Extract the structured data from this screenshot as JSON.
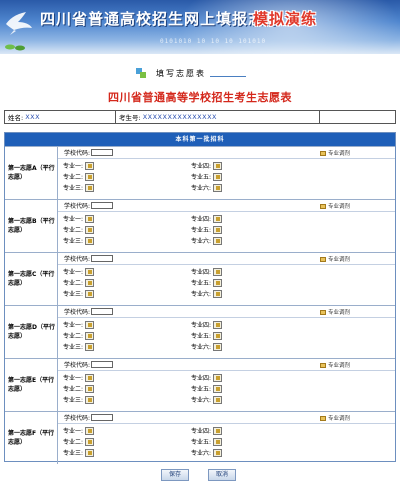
{
  "banner": {
    "title": "四川省普通高校招生网上填报志愿",
    "tag": "模拟演练",
    "deco": "0101010   10 10 10 101010"
  },
  "form_header": {
    "label": "填写志愿表"
  },
  "form_title": "四川省普通高等学校招生考生志愿表",
  "info": {
    "name_label": "姓名:",
    "name_value": "XXX",
    "exam_label": "考生号:",
    "exam_value": "XXXXXXXXXXXXXXX"
  },
  "section_header": "本科第一批招科",
  "school_code_label": "学校代码:",
  "code_button_label": "专业调剂",
  "choices": [
    {
      "label": "第一志愿A（平行志愿）",
      "majors": [
        "专业一:",
        "专业二:",
        "专业三:",
        "专业四:",
        "专业五:",
        "专业六:"
      ]
    },
    {
      "label": "第一志愿B（平行志愿）",
      "majors": [
        "专业一:",
        "专业二:",
        "专业三:",
        "专业四:",
        "专业五:",
        "专业六:"
      ]
    },
    {
      "label": "第一志愿C（平行志愿）",
      "majors": [
        "专业一:",
        "专业二:",
        "专业三:",
        "专业四:",
        "专业五:",
        "专业六:"
      ]
    },
    {
      "label": "第一志愿D（平行志愿）",
      "majors": [
        "专业一:",
        "专业二:",
        "专业三:",
        "专业四:",
        "专业五:",
        "专业六:"
      ]
    },
    {
      "label": "第一志愿E（平行志愿）",
      "majors": [
        "专业一:",
        "专业二:",
        "专业三:",
        "专业四:",
        "专业五:",
        "专业六:"
      ]
    },
    {
      "label": "第一志愿F（平行志愿）",
      "majors": [
        "专业一:",
        "专业二:",
        "专业三:",
        "专业四:",
        "专业五:",
        "专业六:"
      ]
    }
  ],
  "buttons": {
    "save": "保存",
    "cancel": "取消"
  },
  "colors": {
    "title_red": "#d4281c",
    "header_blue": "#1f5fb8",
    "banner_blue": "#2a5aa8"
  }
}
